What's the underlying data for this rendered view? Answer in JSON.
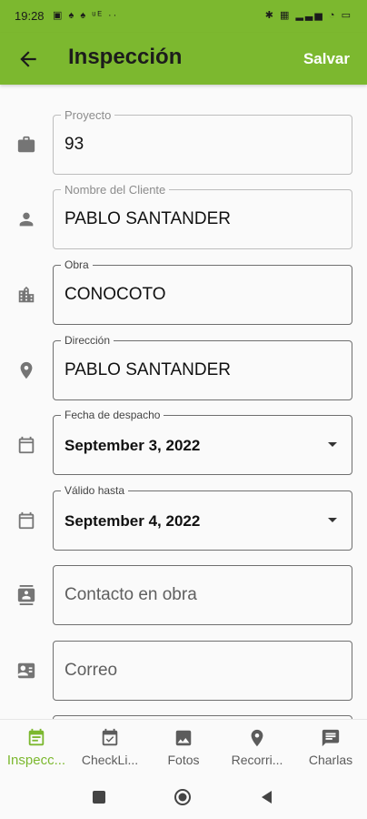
{
  "status_bar": {
    "time": "19:28",
    "left_icons": "▣ ♠ ♠ ᵘᴱ ··",
    "right_icons": "✱ ▦ ▂▃▅ ◔ ▭"
  },
  "app_bar": {
    "title": "Inspección",
    "save_label": "Salvar",
    "back_icon": "arrow-back-icon"
  },
  "fields": [
    {
      "label": "Proyecto",
      "value": "93",
      "icon": "briefcase-icon"
    },
    {
      "label": "Nombre del Cliente",
      "value": "PABLO SANTANDER",
      "icon": "person-icon"
    },
    {
      "label": "Obra",
      "value": "CONOCOTO",
      "icon": "city-icon"
    },
    {
      "label": "Dirección",
      "value": "PABLO SANTANDER",
      "icon": "location-pin-icon"
    },
    {
      "label": "Fecha de despacho",
      "value": "September 3, 2022",
      "icon": "calendar-icon"
    },
    {
      "label": "Válido hasta",
      "value": "September 4, 2022",
      "icon": "calendar-icon"
    },
    {
      "placeholder": "Contacto en obra",
      "icon": "contact-card-icon"
    },
    {
      "placeholder": "Correo",
      "icon": "id-card-icon"
    }
  ],
  "bottom_nav": [
    {
      "label": "Inspecc...",
      "icon": "event-note-icon",
      "active": true
    },
    {
      "label": "CheckLi...",
      "icon": "event-check-icon",
      "active": false
    },
    {
      "label": "Fotos",
      "icon": "image-icon",
      "active": false
    },
    {
      "label": "Recorri...",
      "icon": "place-icon",
      "active": false
    },
    {
      "label": "Charlas",
      "icon": "chat-icon",
      "active": false
    }
  ],
  "colors": {
    "accent": "#7cb82f",
    "icon_gray": "#757575",
    "field_border": "#bdbdbd"
  }
}
